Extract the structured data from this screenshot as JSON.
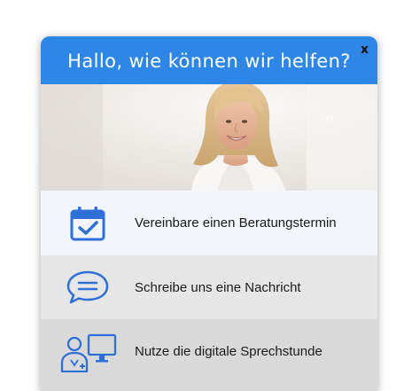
{
  "header": {
    "title": "Hallo, wie können wir helfen?",
    "close_label": "x",
    "color": "#2e86e6"
  },
  "hero": {
    "image": "portrait-photo",
    "watermark": "fury"
  },
  "options": [
    {
      "label": "Vereinbare einen Beratungstermin",
      "icon": "calendar-check-icon"
    },
    {
      "label": "Schreibe uns eine Nachricht",
      "icon": "chat-bubble-icon"
    },
    {
      "label": "Nutze die digitale Sprechstunde",
      "icon": "video-consultation-icon"
    }
  ],
  "colors": {
    "accent": "#2e86e6",
    "option1_bg": "#f2f6fa",
    "option2_bg": "#e6e6e6",
    "option3_bg": "#d9d9d9"
  }
}
